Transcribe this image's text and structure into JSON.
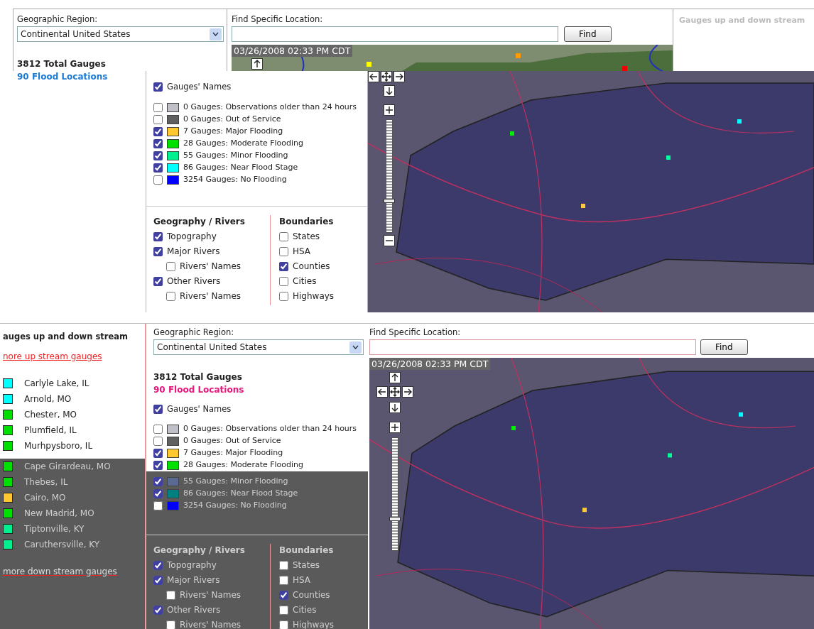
{
  "top": {
    "region_label": "Geographic Region:",
    "region_value": "Continental United States",
    "total_gauges": "3812 Total Gauges",
    "flood_locations": "90 Flood Locations",
    "find_label": "Find Specific Location:",
    "find_button": "Find",
    "side_title": "Gauges up and down stream",
    "map": {
      "timestamp": "03/26/2008 02:33 PM CDT",
      "zoom": {
        "level": 0.27
      }
    },
    "gauge_names": {
      "label": "Gauges' Names",
      "checked": true
    },
    "legend": [
      {
        "label": "0 Gauges: Observations older than 24 hours",
        "checked": false,
        "color": "#c0c0c8"
      },
      {
        "label": "0 Gauges: Out of Service",
        "checked": false,
        "color": "#606060"
      },
      {
        "label": "7 Gauges: Major Flooding",
        "checked": true,
        "color": "#ffc830"
      },
      {
        "label": "28 Gauges: Moderate Flooding",
        "checked": true,
        "color": "#00e000"
      },
      {
        "label": "55 Gauges: Minor Flooding",
        "checked": true,
        "color": "#00f090"
      },
      {
        "label": "86 Gauges: Near Flood Stage",
        "checked": true,
        "color": "#00ffff"
      },
      {
        "label": "3254 Gauges: No Flooding",
        "checked": false,
        "color": "#0000ff"
      }
    ],
    "geography_title": "Geography / Rivers",
    "geography": [
      {
        "label": "Topography",
        "checked": true
      },
      {
        "label": "Major Rivers",
        "checked": true,
        "children": [
          {
            "label": "Rivers' Names",
            "checked": false
          }
        ]
      },
      {
        "label": "Other Rivers",
        "checked": true,
        "children": [
          {
            "label": "Rivers' Names",
            "checked": false
          }
        ]
      }
    ],
    "boundaries_title": "Boundaries",
    "boundaries": [
      {
        "label": "States",
        "checked": false
      },
      {
        "label": "HSA",
        "checked": false
      },
      {
        "label": "Counties",
        "checked": true
      },
      {
        "label": "Cities",
        "checked": false
      },
      {
        "label": "Highways",
        "checked": false
      }
    ]
  },
  "bottom": {
    "stream_title": "auges up and down stream",
    "upstream_link": "nore up stream gauges",
    "gauges": [
      {
        "name": "Carlyle Lake, IL",
        "color": "#00ffff"
      },
      {
        "name": "Arnold, MO",
        "color": "#00ffff"
      },
      {
        "name": "Chester, MO",
        "color": "#00e000"
      },
      {
        "name": "Plumfield, IL",
        "color": "#00e000"
      },
      {
        "name": "Murhpysboro, IL",
        "color": "#00e000"
      },
      {
        "name": "Cape Girardeau, MO",
        "color": "#00e000"
      },
      {
        "name": "Thebes, IL",
        "color": "#00e000"
      },
      {
        "name": "Cairo, MO",
        "color": "#ffc830"
      },
      {
        "name": "New Madrid, MO",
        "color": "#00e000"
      },
      {
        "name": "Tiptonville, KY",
        "color": "#00f090"
      },
      {
        "name": "Caruthersville, KY",
        "color": "#00f090"
      }
    ],
    "downstream_link": "more down stream gauges",
    "region_label": "Geographic Region:",
    "region_value": "Continental United States",
    "total_gauges": "3812 Total Gauges",
    "flood_locations": "90 Flood Locations",
    "find_label": "Find Specific Location:",
    "find_button": "Find",
    "map": {
      "timestamp": "03/26/2008 02:33 PM CDT",
      "zoom": {
        "level": 0.27
      }
    },
    "gauge_names": {
      "label": "Gauges' Names",
      "checked": true
    },
    "legend": [
      {
        "label": "0 Gauges: Observations older than 24 hours",
        "checked": false,
        "color": "#c0c0c8"
      },
      {
        "label": "0 Gauges: Out of Service",
        "checked": false,
        "color": "#606060"
      },
      {
        "label": "7 Gauges: Major Flooding",
        "checked": true,
        "color": "#ffc830"
      },
      {
        "label": "28 Gauges: Moderate Flooding",
        "checked": true,
        "color": "#00e000"
      },
      {
        "label": "55 Gauges: Minor Flooding",
        "checked": true,
        "color": "#5a6a90"
      },
      {
        "label": "86 Gauges: Near Flood Stage",
        "checked": true,
        "color": "#008080"
      },
      {
        "label": "3254 Gauges: No Flooding",
        "checked": false,
        "color": "#0000ff"
      }
    ],
    "geography_title": "Geography / Rivers",
    "geography": [
      {
        "label": "Topography",
        "checked": true
      },
      {
        "label": "Major Rivers",
        "checked": true,
        "children": [
          {
            "label": "Rivers' Names",
            "checked": false
          }
        ]
      },
      {
        "label": "Other Rivers",
        "checked": true,
        "children": [
          {
            "label": "Rivers' Names",
            "checked": false
          }
        ]
      }
    ],
    "boundaries_title": "Boundaries",
    "boundaries": [
      {
        "label": "States",
        "checked": false
      },
      {
        "label": "HSA",
        "checked": false
      },
      {
        "label": "Counties",
        "checked": true
      },
      {
        "label": "Cities",
        "checked": false
      },
      {
        "label": "Highways",
        "checked": false
      }
    ]
  }
}
